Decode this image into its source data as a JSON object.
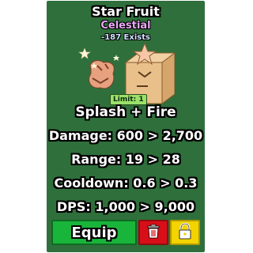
{
  "item": {
    "name": "Star Fruit",
    "rarity": "Celestial",
    "exists": "-187 Exists",
    "limit": "Limit: 1",
    "ability": "Splash + Fire"
  },
  "stats": {
    "damage": "Damage: 600 > 2,700",
    "range": "Range: 19 > 28",
    "cooldown": "Cooldown: 0.6 > 0.3",
    "dps": "DPS: 1,000 > 9,000"
  },
  "buttons": {
    "equip": "Equip",
    "delete_icon": "trash-icon",
    "lock_icon": "lock-icon"
  },
  "colors": {
    "card_bg": "#2f6f3b",
    "rarity": "#e9a8f5",
    "equip": "#19b53b",
    "delete": "#d80f18",
    "lock": "#f3d300"
  }
}
